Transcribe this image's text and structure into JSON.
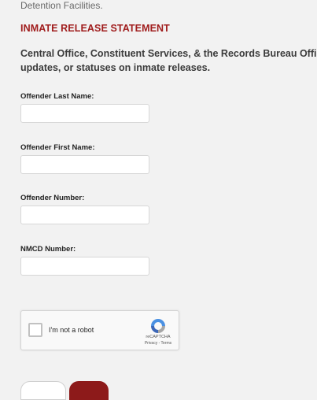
{
  "intro": {
    "trailing_text": "Detention Facilities."
  },
  "section": {
    "heading": "INMATE RELEASE STATEMENT",
    "statement_line1": "Central Office, Constituent Services, & the Records Bureau Office",
    "statement_line2": "updates, or statuses on inmate releases."
  },
  "form": {
    "fields": [
      {
        "label": "Offender Last Name:",
        "value": ""
      },
      {
        "label": "Offender First Name:",
        "value": ""
      },
      {
        "label": "Offender Number:",
        "value": ""
      },
      {
        "label": "NMCD Number:",
        "value": ""
      }
    ]
  },
  "captcha": {
    "label": "I'm not a robot",
    "brand": "reCAPTCHA",
    "links": "Privacy - Terms",
    "checked": false
  },
  "colors": {
    "heading": "#a01d1d",
    "primary_button": "#8d1a1a",
    "background": "#f2f2f2"
  }
}
